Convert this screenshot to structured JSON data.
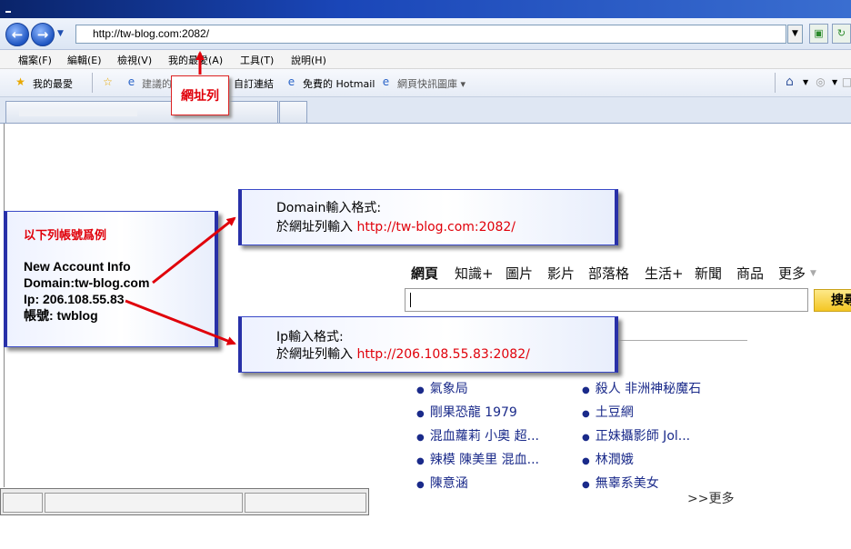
{
  "browser": {
    "address": "http://tw-blog.com:2082/",
    "menu": [
      "檔案(F)",
      "編輯(E)",
      "檢視(V)",
      "我的最愛(A)",
      "工具(T)",
      "說明(H)"
    ],
    "favorites": {
      "label": "我的最愛",
      "items": [
        "建議的",
        "自訂連結",
        "免費的 Hotmail",
        "網頁快訊圖庫 ▾"
      ]
    }
  },
  "annotations": {
    "address_label": "網址列",
    "account_box": {
      "heading": "以下列帳號爲例",
      "lines": [
        "New Account Info",
        "Domain:tw-blog.com",
        "Ip: 206.108.55.83",
        "帳號: twblog"
      ]
    },
    "domain_box": {
      "title": "Domain輸入格式:",
      "prefix": "於網址列輸入 ",
      "url": "http://tw-blog.com:2082/"
    },
    "ip_box": {
      "title": "Ip輸入格式:",
      "prefix": "於網址列輸入 ",
      "url": "http://206.108.55.83:2082/"
    },
    "colors": {
      "arrow": "#e0000a",
      "box_border": "#2830a8"
    }
  },
  "search": {
    "tabs": [
      "網頁",
      "知識+",
      "圖片",
      "影片",
      "部落格",
      "生活+",
      "新聞",
      "商品",
      "更多"
    ],
    "button": "搜尋",
    "hot_left": [
      "氣象局",
      "剛果恐龍 1979",
      "混血蘿莉 小奧 超...",
      "辣模 陳美里 混血...",
      "陳意涵"
    ],
    "hot_right": [
      "殺人 非洲神秘魔石",
      "土豆網",
      "正妹攝影師 Jol...",
      "林潤娥",
      "無辜系美女"
    ],
    "more": ">>更多"
  }
}
